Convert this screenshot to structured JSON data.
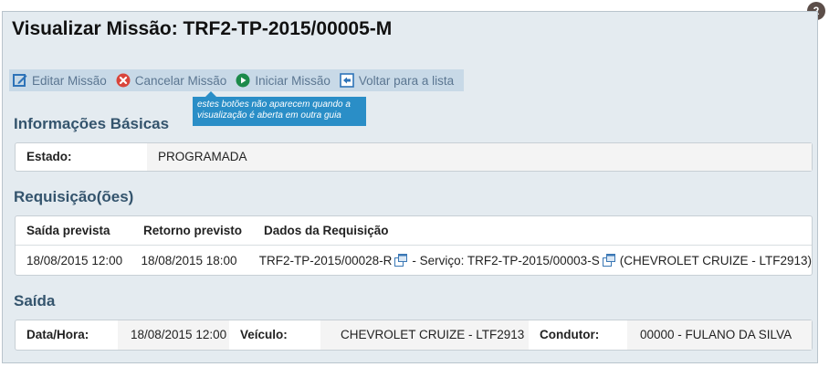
{
  "step_badge": "2",
  "page_title": "Visualizar Missão: TRF2-TP-2015/00005-M",
  "toolbar": {
    "edit": "Editar Missão",
    "cancel": "Cancelar Missão",
    "start": "Iniciar Missão",
    "back": "Voltar para a lista"
  },
  "tooltip": "estes botões não aparecem quando a visualização é aberta em outra guia",
  "basic_info": {
    "title": "Informações Básicas",
    "estado_label": "Estado:",
    "estado_value": "PROGRAMADA"
  },
  "requisicoes": {
    "title": "Requisição(ões)",
    "headers": [
      "Saída prevista",
      "Retorno previsto",
      "Dados da Requisição"
    ],
    "rows": [
      {
        "saida": "18/08/2015 12:00",
        "retorno": "18/08/2015 18:00",
        "req_code": "TRF2-TP-2015/00028-R",
        "service_text": "- Serviço: TRF2-TP-2015/00003-S",
        "vehicle_text": "(CHEVROLET CRUIZE - LTF2913)"
      }
    ]
  },
  "saida": {
    "title": "Saída",
    "datahora_label": "Data/Hora:",
    "datahora_value": "18/08/2015 12:00",
    "veiculo_label": "Veículo:",
    "veiculo_value": "CHEVROLET CRUIZE - LTF2913",
    "condutor_label": "Condutor:",
    "condutor_value": "00000 - FULANO DA SILVA"
  },
  "colors": {
    "frame_bg": "#e4ebf0",
    "toolbar_bg": "#c8d9e7",
    "link": "#5b7691",
    "section_title": "#34546d",
    "tooltip_bg": "#2a8ec7",
    "cancel_red": "#d9453b",
    "start_green": "#1c8a4a",
    "edit_blue": "#2e73b8"
  },
  "icons": {
    "edit": "edit-icon",
    "cancel": "cancel-circle-icon",
    "start": "play-circle-icon",
    "back": "back-arrow-icon",
    "external": "external-link-icon"
  }
}
